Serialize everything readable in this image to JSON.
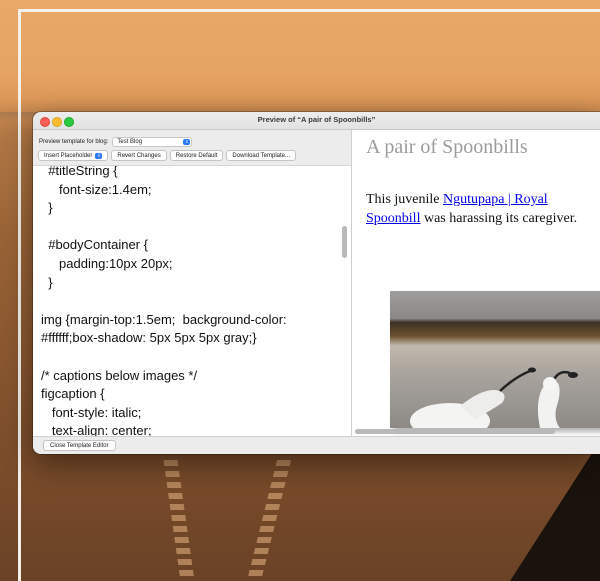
{
  "window": {
    "title": "Preview of “A pair of Spoonbills”"
  },
  "toolbar": {
    "blog_label": "Preview template for blog:",
    "blog_value": "Test Blog",
    "insert_placeholder": "Insert Placeholder",
    "revert_changes": "Revert Changes",
    "restore_default": "Restore Default",
    "download_template": "Download Template..."
  },
  "editor": {
    "code": "  #titleString {\n     font-size:1.4em;\n  }\n\n  #bodyContainer {\n     padding:10px 20px;\n  }\n\nimg {margin-top:1.5em;  background-color:\n#ffffff;box-shadow: 5px 5px 5px gray;}\n\n/* captions below images */\nfigcaption {\n   font-style: italic;\n   text-align: center;"
  },
  "preview": {
    "title": "A pair of Spoonbills",
    "text_before": "This juvenile ",
    "link_text": "Ngutupapa | Royal Spoonbill",
    "text_after": " was harassing its caregiver."
  },
  "footer": {
    "close_label": "Close Template Editor"
  },
  "colors": {
    "close": "#ff5f57",
    "minimize": "#febc2e",
    "maximize": "#28c840",
    "accent": "#2d7cf6",
    "link": "#0000ee"
  }
}
